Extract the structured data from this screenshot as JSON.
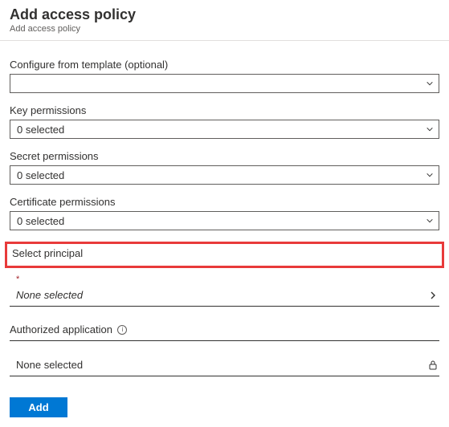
{
  "header": {
    "title": "Add access policy",
    "subtitle": "Add access policy"
  },
  "fields": {
    "template": {
      "label": "Configure from template (optional)",
      "value": ""
    },
    "key_permissions": {
      "label": "Key permissions",
      "value": "0 selected"
    },
    "secret_permissions": {
      "label": "Secret permissions",
      "value": "0 selected"
    },
    "certificate_permissions": {
      "label": "Certificate permissions",
      "value": "0 selected"
    }
  },
  "principal": {
    "label": "Select principal",
    "required_mark": "*",
    "value": "None selected"
  },
  "authorized_app": {
    "label": "Authorized application",
    "value": "None selected"
  },
  "footer": {
    "add_label": "Add"
  }
}
